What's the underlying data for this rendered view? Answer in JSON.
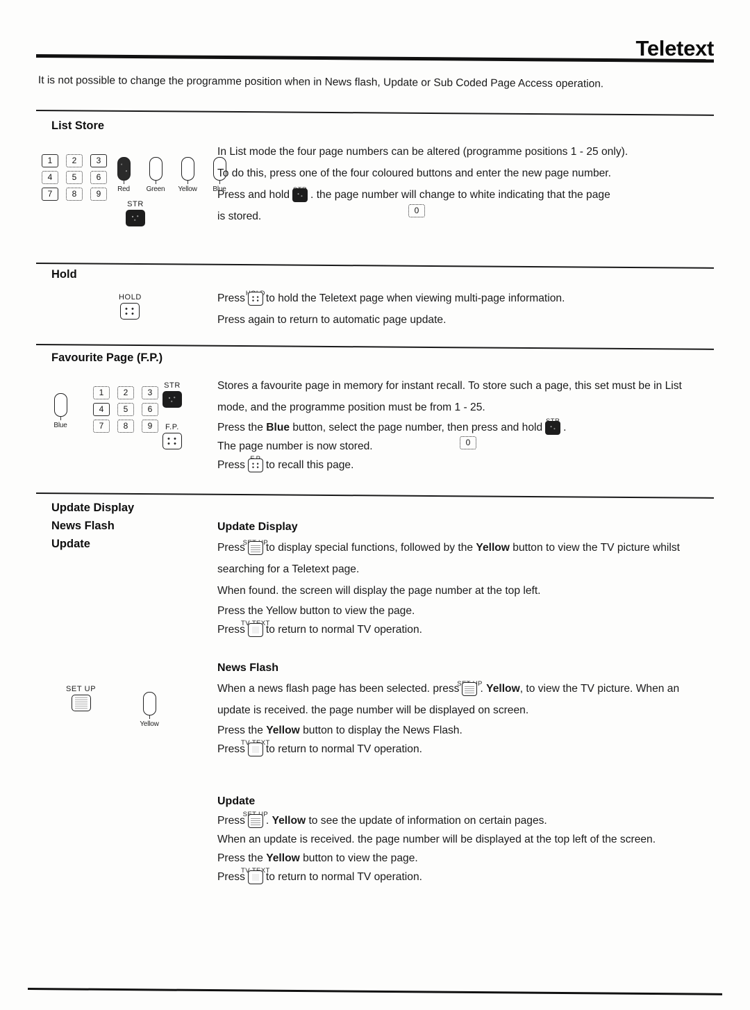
{
  "header": {
    "title": "Teletext"
  },
  "intro": "It is not possible to change the programme position when in News flash, Update or Sub Coded Page Access operation.",
  "keypad": {
    "rows": [
      [
        "1",
        "2",
        "3"
      ],
      [
        "4",
        "5",
        "6"
      ],
      [
        "7",
        "8",
        "9"
      ]
    ],
    "zero": "0"
  },
  "colour_buttons": [
    {
      "label": "Red",
      "filled": true
    },
    {
      "label": "Green",
      "filled": false
    },
    {
      "label": "Yellow",
      "filled": false
    },
    {
      "label": "Blue",
      "filled": false
    }
  ],
  "sections": [
    {
      "id": "list-store",
      "title": "List Store",
      "str_key_label": "STR",
      "paragraphs": [
        "In List mode the four page numbers can be altered (programme positions 1 - 25 only).",
        "To do this, press one of the four coloured buttons and enter the new page number.",
        "is stored."
      ],
      "press_hold_prefix": "Press and hold",
      "press_hold_icon": "STR",
      "press_hold_suffix": ". the page number will change to white indicating that the page"
    },
    {
      "id": "hold",
      "title": "Hold",
      "art_key_label": "HOLD",
      "line1_prefix": "Press",
      "line1_icon": "HOLD",
      "line1_suffix": "to hold the Teletext page when viewing multi-page information.",
      "line2": "Press again to return to automatic page update."
    },
    {
      "id": "favourite-page",
      "title": "Favourite Page (F.P.)",
      "blue_label": "Blue",
      "str_key_label": "STR",
      "fp_key_label": "F.P.",
      "para1": "Stores a favourite page in memory for instant recall. To store such a page, this set must be in List mode, and the programme position must be from 1 - 25.",
      "line_blue_a": "Press the",
      "line_blue_bold": "Blue",
      "line_blue_b": "button, select the page number, then press and hold",
      "line_blue_icon": "STR",
      "line_blue_c": ".",
      "line_stored": "The page number is now stored.",
      "line_recall_a": "Press",
      "line_recall_icon": "F.P",
      "line_recall_b": "to recall this page."
    },
    {
      "id": "update-display-group",
      "titles": [
        "Update Display",
        "News Flash",
        "Update"
      ],
      "setup_key_label": "SET UP",
      "yellow_label": "Yellow",
      "blocks": [
        {
          "heading": "Update Display",
          "l1a": "Press",
          "l1icon": "SET UP",
          "l1b": "to display special functions, followed by the",
          "l1bold": "Yellow",
          "l1c": "button to view the TV picture whilst searching for a Teletext page.",
          "l2": "When found. the screen will display the page number at the top left.",
          "l3": "Press the Yellow button to view the page.",
          "l4a": "Press",
          "l4icon": "TV TEXT",
          "l4b": "to return to normal TV operation."
        },
        {
          "heading": "News Flash",
          "l1a": "When a news flash page has been selected. press",
          "l1icon": "SET UP",
          "l1b": ".",
          "l1bold": "Yellow",
          "l1c": ", to view the TV picture. When an update is received. the page number will be displayed on screen.",
          "l3a": "Press the",
          "l3bold": "Yellow",
          "l3b": "button to display the News Flash.",
          "l4a": "Press",
          "l4icon": "TV TEXT",
          "l4b": "to return to normal TV operation."
        },
        {
          "heading": "Update",
          "l1a": "Press",
          "l1icon": "SET UP",
          "l1b": ".",
          "l1bold": "Yellow",
          "l1c": "to see the update of information on certain pages.",
          "l2": "When an update is received. the page number will be displayed at the top left of the screen.",
          "l3a": "Press the",
          "l3bold": "Yellow",
          "l3b": "button to view the page.",
          "l4a": "Press",
          "l4icon": "TV TEXT",
          "l4b": "to return to normal TV operation."
        }
      ]
    }
  ]
}
